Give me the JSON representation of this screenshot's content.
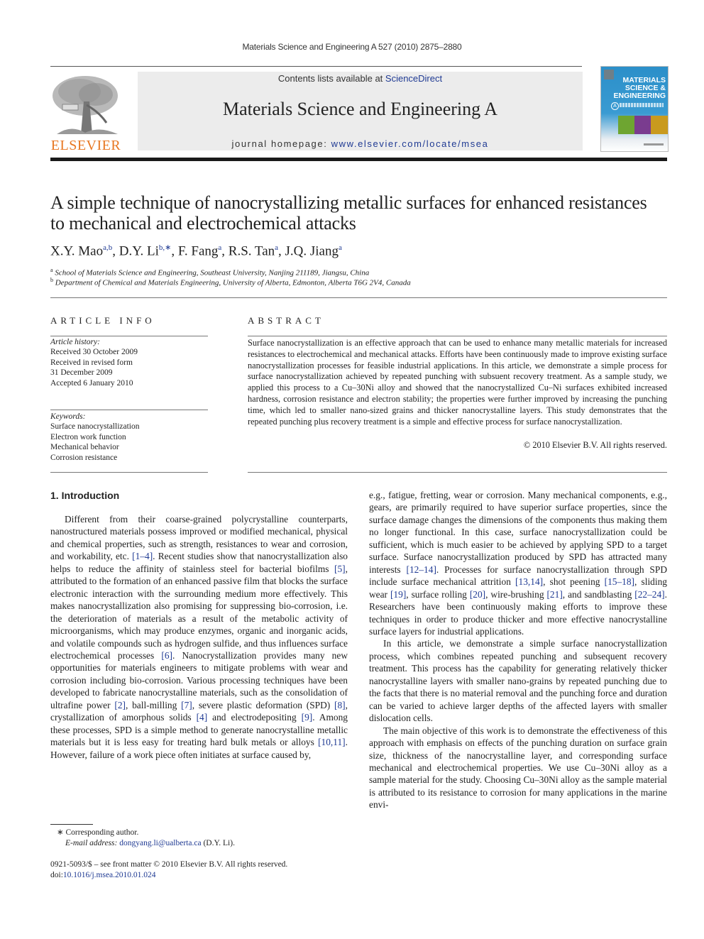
{
  "running_head": "Materials Science and Engineering A 527 (2010) 2875–2880",
  "header": {
    "publisher_logo_text": "ELSEVIER",
    "contents_prefix": "Contents lists available at ",
    "contents_link": "ScienceDirect",
    "journal_title": "Materials Science and Engineering A",
    "homepage_prefix": "journal homepage: ",
    "homepage_link": "www.elsevier.com/locate/msea",
    "cover": {
      "title_line1": "MATERIALS",
      "title_line2": "SCIENCE &",
      "title_line3": "ENGINEERING",
      "series_letter": "A"
    },
    "colors": {
      "publisher_orange": "#e87722",
      "link_blue": "#1f3a93",
      "banner_gray": "#ececec"
    }
  },
  "article": {
    "title": "A simple technique of nanocrystallizing metallic surfaces for enhanced resistances to mechanical and electrochemical attacks",
    "authors": [
      {
        "name": "X.Y. Mao",
        "sup": "a,b",
        "sep": ", "
      },
      {
        "name": "D.Y. Li",
        "sup": "b,∗",
        "sep": ", "
      },
      {
        "name": "F. Fang",
        "sup": "a",
        "sep": ", "
      },
      {
        "name": "R.S. Tan",
        "sup": "a",
        "sep": ", "
      },
      {
        "name": "J.Q. Jiang",
        "sup": "a",
        "sep": ""
      }
    ],
    "affiliations": [
      {
        "mark": "a",
        "text": "School of Materials Science and Engineering, Southeast University, Nanjing 211189, Jiangsu, China"
      },
      {
        "mark": "b",
        "text": "Department of Chemical and Materials Engineering, University of Alberta, Edmonton, Alberta T6G 2V4, Canada"
      }
    ]
  },
  "article_info": {
    "heading": "ARTICLE INFO",
    "history_label": "Article history:",
    "history": [
      "Received 30 October 2009",
      "Received in revised form",
      "31 December 2009",
      "Accepted 6 January 2010"
    ],
    "keywords_label": "Keywords:",
    "keywords": [
      "Surface nanocrystallization",
      "Electron work function",
      "Mechanical behavior",
      "Corrosion resistance"
    ]
  },
  "abstract": {
    "heading": "ABSTRACT",
    "text": "Surface nanocrystallization is an effective approach that can be used to enhance many metallic materials for increased resistances to electrochemical and mechanical attacks. Efforts have been continuously made to improve existing surface nanocrystallization processes for feasible industrial applications. In this article, we demonstrate a simple process for surface nanocrystallization achieved by repeated punching with subsuent recovery treatment. As a sample study, we applied this process to a Cu–30Ni alloy and showed that the nanocrystallized Cu–Ni surfaces exhibited increased hardness, corrosion resistance and electron stability; the properties were further improved by increasing the punching time, which led to smaller nano-sized grains and thicker nanocrystalline layers. This study demonstrates that the repeated punching plus recovery treatment is a simple and effective process for surface nanocrystallization.",
    "copyright": "© 2010 Elsevier B.V. All rights reserved."
  },
  "introduction": {
    "heading": "1.  Introduction",
    "left_column": [
      [
        {
          "t": "Different from their coarse-grained polycrystalline counterparts, nanostructured materials possess improved or modified mechanical, physical and chemical properties, such as strength, resistances to wear and corrosion, and workability, etc. "
        },
        {
          "t": "[1–4]",
          "ref": true
        },
        {
          "t": ". Recent studies show that nanocrystallization also helps to reduce the affinity of stainless steel for bacterial biofilms "
        },
        {
          "t": "[5]",
          "ref": true
        },
        {
          "t": ", attributed to the formation of an enhanced passive film that blocks the surface electronic interaction with the surrounding medium more effectively. This makes nanocrystallization also promising for suppressing bio-corrosion, i.e. the deterioration of materials as a result of the metabolic activity of microorganisms, which may produce enzymes, organic and inorganic acids, and volatile compounds such as hydrogen sulfide, and thus influences surface electrochemical processes "
        },
        {
          "t": "[6]",
          "ref": true
        },
        {
          "t": ". Nanocrystallization provides many new opportunities for materials engineers to mitigate problems with wear and corrosion including bio-corrosion. Various processing techniques have been developed to fabricate nanocrystalline materials, such as the consolidation of ultrafine power "
        },
        {
          "t": "[2]",
          "ref": true
        },
        {
          "t": ", ball-milling "
        },
        {
          "t": "[7]",
          "ref": true
        },
        {
          "t": ", severe plastic deformation (SPD) "
        },
        {
          "t": "[8]",
          "ref": true
        },
        {
          "t": ", crystallization of amorphous solids "
        },
        {
          "t": "[4]",
          "ref": true
        },
        {
          "t": " and electrodepositing "
        },
        {
          "t": "[9]",
          "ref": true
        },
        {
          "t": ". Among these processes, SPD is a simple method to generate nanocrystalline metallic materials but it is less easy for treating hard bulk metals or alloys "
        },
        {
          "t": "[10,11]",
          "ref": true
        },
        {
          "t": ". However, failure of a work piece often initiates at surface caused by,"
        }
      ]
    ],
    "right_column": [
      [
        {
          "t": "e.g., fatigue, fretting, wear or corrosion. Many mechanical components, e.g., gears, are primarily required to have superior surface properties, since the surface damage changes the dimensions of the components thus making them no longer functional. In this case, surface nanocrystallization could be sufficient, which is much easier to be achieved by applying SPD to a target surface. Surface nanocrystallization produced by SPD has attracted many interests "
        },
        {
          "t": "[12–14]",
          "ref": true
        },
        {
          "t": ". Processes for surface nanocrystallization through SPD include surface mechanical attrition "
        },
        {
          "t": "[13,14]",
          "ref": true
        },
        {
          "t": ", shot peening "
        },
        {
          "t": "[15–18]",
          "ref": true
        },
        {
          "t": ", sliding wear "
        },
        {
          "t": "[19]",
          "ref": true
        },
        {
          "t": ", surface rolling "
        },
        {
          "t": "[20]",
          "ref": true
        },
        {
          "t": ", wire-brushing "
        },
        {
          "t": "[21]",
          "ref": true
        },
        {
          "t": ", and sandblasting "
        },
        {
          "t": "[22–24]",
          "ref": true
        },
        {
          "t": ". Researchers have been continuously making efforts to improve these techniques in order to produce thicker and more effective nanocrystalline surface layers for industrial applications."
        }
      ],
      [
        {
          "t": "In this article, we demonstrate a simple surface nanocrystallization process, which combines repeated punching and subsequent recovery treatment. This process has the capability for generating relatively thicker nanocrystalline layers with smaller nano-grains by repeated punching due to the facts that there is no material removal and the punching force and duration can be varied to achieve larger depths of the affected layers with smaller dislocation cells."
        }
      ],
      [
        {
          "t": "The main objective of this work is to demonstrate the effectiveness of this approach with emphasis on effects of the punching duration on surface grain size, thickness of the nanocrystalline layer, and corresponding surface mechanical and electrochemical properties. We use Cu–30Ni alloy as a sample material for the study. Choosing Cu–30Ni alloy as the sample material is attributed to its resistance to corrosion for many applications in the marine envi-"
        }
      ]
    ]
  },
  "footnote": {
    "mark": "∗",
    "corresponding": "Corresponding author.",
    "email_label": "E-mail address:",
    "email": "dongyang.li@ualberta.ca",
    "email_suffix": " (D.Y. Li)."
  },
  "issn_line": "0921-5093/$ – see front matter © 2010 Elsevier B.V. All rights reserved.",
  "doi_prefix": "doi:",
  "doi": "10.1016/j.msea.2010.01.024"
}
